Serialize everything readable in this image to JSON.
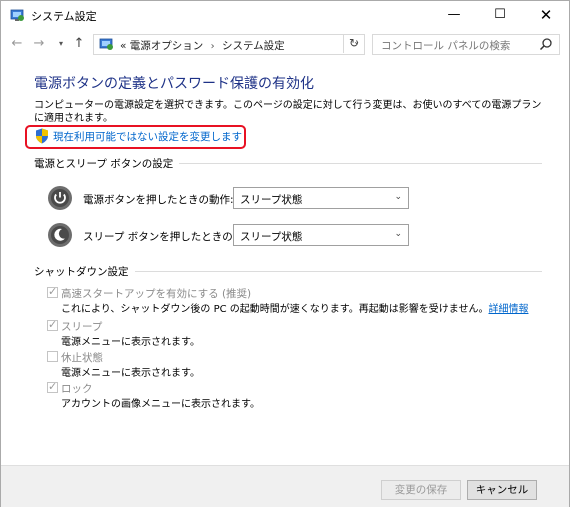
{
  "window": {
    "title": "システム設定",
    "minimize": "—",
    "maximize": "☐",
    "close": "✕"
  },
  "nav": {
    "back": "←",
    "forward": "→",
    "recent": "▾",
    "up": "↑",
    "address_prefix": "«",
    "breadcrumb": [
      "電源オプション",
      "システム設定"
    ],
    "separator": "›",
    "dropdown": "⌄",
    "refresh": "↻",
    "search_placeholder": "コントロール パネルの検索"
  },
  "page": {
    "heading": "電源ボタンの定義とパスワード保護の有効化",
    "description": "コンピューターの電源設定を選択できます。このページの設定に対して行う変更は、お使いのすべての電源プランに適用されます。",
    "change_link": "現在利用可能ではない設定を変更します"
  },
  "power_section": {
    "title": "電源とスリープ ボタンの設定",
    "rows": [
      {
        "label": "電源ボタンを押したときの動作:",
        "value": "スリープ状態",
        "icon": "power-icon"
      },
      {
        "label": "スリープ ボタンを押したときの動作:",
        "value": "スリープ状態",
        "icon": "sleep-icon"
      }
    ]
  },
  "shutdown_section": {
    "title": "シャットダウン設定",
    "options": [
      {
        "label": "高速スタートアップを有効にする (推奨)",
        "checked": true,
        "desc": "これにより、シャットダウン後の PC の起動時間が速くなります。再起動は影響を受けません。",
        "link": "詳細情報"
      },
      {
        "label": "スリープ",
        "checked": true,
        "desc": "電源メニューに表示されます。"
      },
      {
        "label": "休止状態",
        "checked": false,
        "desc": "電源メニューに表示されます。"
      },
      {
        "label": "ロック",
        "checked": true,
        "desc": "アカウントの画像メニューに表示されます。"
      }
    ]
  },
  "footer": {
    "save_label": "変更の保存",
    "cancel_label": "キャンセル"
  },
  "colors": {
    "heading": "#1e3287",
    "link": "#0066cc",
    "highlight": "#e81123"
  }
}
